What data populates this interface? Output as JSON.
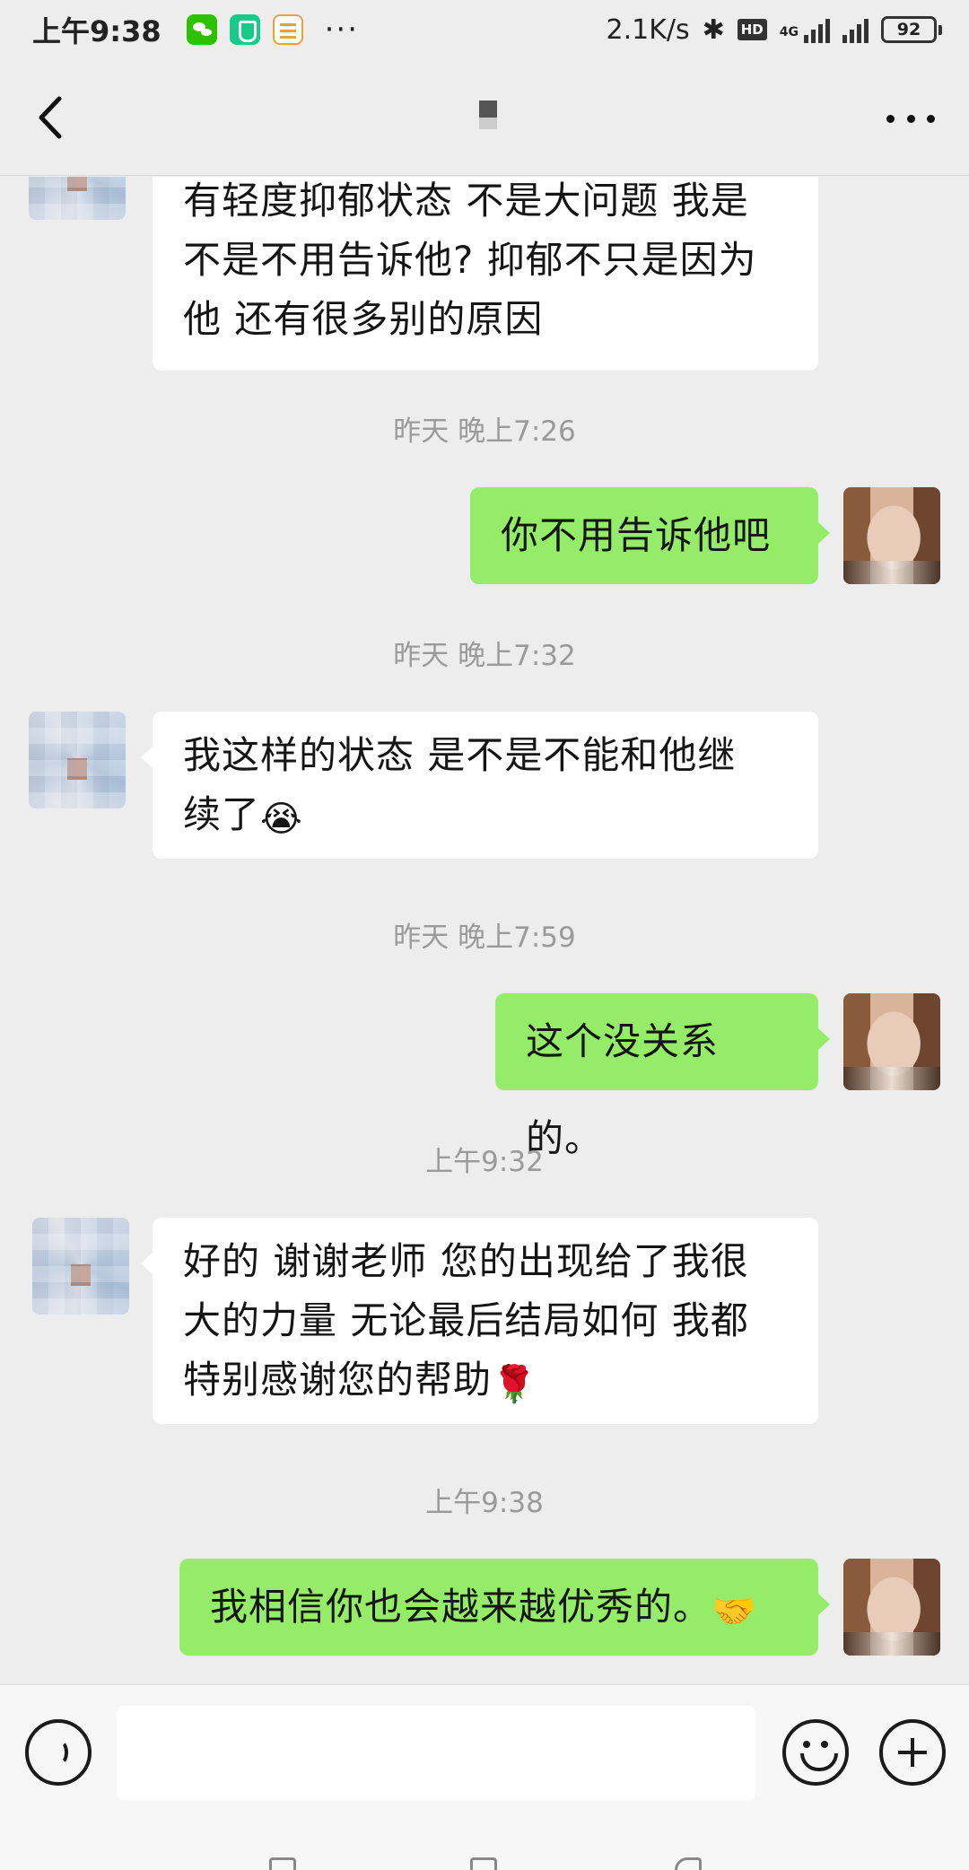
{
  "status_bar": {
    "time": "上午9:38",
    "network_speed": "2.1K/s",
    "network_type": "4G",
    "battery": "92",
    "more_notifications": "···",
    "hd_badge": "HD",
    "app_icons": [
      "wechat-icon",
      "shield-icon",
      "note-icon"
    ]
  },
  "nav": {
    "back_icon": "chevron-left-icon",
    "more_icon": "ellipsis-icon"
  },
  "messages": [
    {
      "type": "incoming",
      "text": "有轻度抑郁状态 不是大问题 我是\n不是不用告诉他? 抑郁不只是因为\n他 还有很多别的原因"
    },
    {
      "type": "time",
      "text": "昨天 晚上7:26"
    },
    {
      "type": "outgoing",
      "text": "你不用告诉他吧"
    },
    {
      "type": "time",
      "text": "昨天 晚上7:32"
    },
    {
      "type": "incoming",
      "text": "我这样的状态 是不是不能和他继\n续了",
      "emoji": "😭"
    },
    {
      "type": "time",
      "text": "昨天 晚上7:59"
    },
    {
      "type": "outgoing",
      "text": "这个没关系的。"
    },
    {
      "type": "time",
      "text": "上午9:32"
    },
    {
      "type": "incoming",
      "text": "好的 谢谢老师 您的出现给了我很\n大的力量 无论最后结局如何 我都\n特别感谢您的帮助",
      "emoji": "🌹"
    },
    {
      "type": "time",
      "text": "上午9:38"
    },
    {
      "type": "outgoing",
      "text": "我相信你也会越来越优秀的。",
      "emoji": "🤝"
    }
  ],
  "input_bar": {
    "value": "",
    "voice_icon": "voice-icon",
    "emoji_icon": "emoji-icon",
    "plus_icon": "plus-icon"
  },
  "colors": {
    "background": "#ededed",
    "incoming_bubble": "#ffffff",
    "outgoing_bubble": "#95ec69",
    "timestamp": "#9a9a9a"
  }
}
